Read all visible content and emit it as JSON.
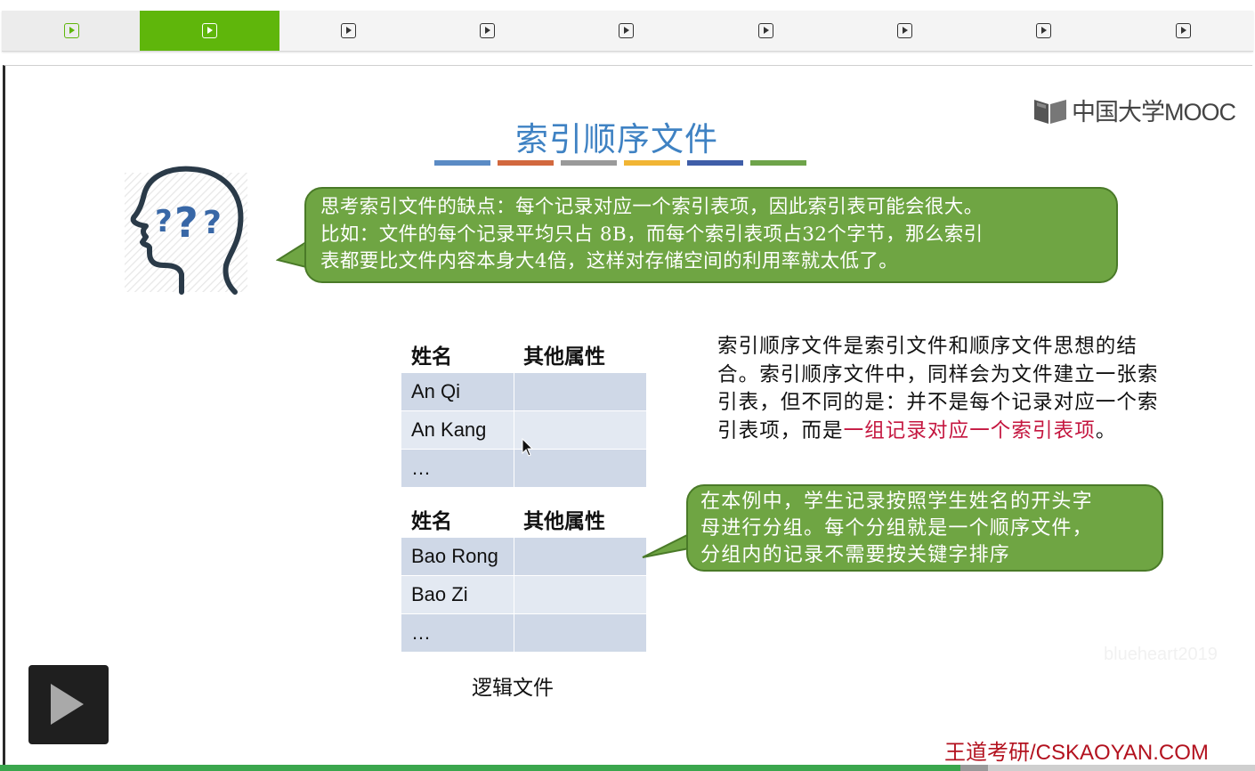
{
  "tabs": {
    "count": 9,
    "active_index": 1,
    "icon": "play-square-icon"
  },
  "slide": {
    "title": "索引顺序文件",
    "title_bar_colors": [
      "#5b8bc5",
      "#d2683e",
      "#9a9a9a",
      "#f1b534",
      "#3f5ea8",
      "#6ea44a"
    ],
    "logo": {
      "text": "中国大学MOOC",
      "icon": "mooc-book-icon"
    },
    "thinking_icon": "head-question-marks-icon",
    "bubble_top": {
      "line1": "思考索引文件的缺点：每个记录对应一个索引表项，因此索引表可能会很大。",
      "line2": "比如：文件的每个记录平均只占 8B，而每个索引表项占32个字节，那么索引",
      "line3": "表都要比文件内容本身大4倍，这样对存储空间的利用率就太低了。"
    },
    "table1": {
      "headers": [
        "姓名",
        "其他属性"
      ],
      "rows": [
        "An Qi",
        "An Kang",
        "…"
      ]
    },
    "table2": {
      "headers": [
        "姓名",
        "其他属性"
      ],
      "rows": [
        "Bao Rong",
        "Bao Zi",
        "…"
      ]
    },
    "caption": "逻辑文件",
    "paragraph": {
      "part1": "索引顺序文件是索引文件和顺序文件思想的结合。索引顺序文件中，同样会为文件建立一张索引表，但不同的是：并不是每个记录对应一个索引表项，而是",
      "highlight": "一组记录对应一个索引表项",
      "part2": "。",
      "highlight_color": "#c4163f"
    },
    "bubble_bottom": {
      "line1": "在本例中，学生记录按照学生姓名的开头字",
      "line2": "母进行分组。每个分组就是一个顺序文件，",
      "line3": "分组内的记录不需要按关键字排序"
    },
    "watermark": "blueheart2019",
    "footer": "王道考研/CSKAOYAN.COM"
  },
  "player": {
    "play_icon": "play-icon",
    "progress_fraction": 0.765,
    "buffer_fraction": 0.022
  },
  "colors": {
    "accent": "#5fb60b",
    "bubble": "#6fa543",
    "title": "#3f82c3"
  }
}
